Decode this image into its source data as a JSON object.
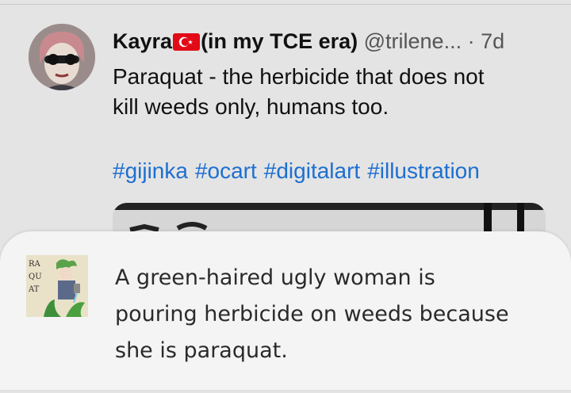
{
  "tweet": {
    "author": {
      "display_name": "Kayra",
      "flag_icon": "turkey-flag-icon",
      "display_name_suffix": "(in my TCE era)",
      "handle": "@trilene...",
      "separator": "·",
      "age": "7d"
    },
    "text": "Paraquat - the herbicide that does not\nkill weeds only, humans too.",
    "hashtags": [
      "#gijinka",
      "#ocart",
      "#digitalart",
      "#illustration"
    ]
  },
  "alt_card": {
    "thumbnail_label": "RA QU AT",
    "alt_text": "A green-haired ugly woman is\npouring herbicide on weeds because\nshe is paraquat."
  },
  "colors": {
    "background": "#e4e4e4",
    "hashtag": "#1d6fd0",
    "card": "#f4f4f4",
    "flag_red": "#e30a17"
  }
}
